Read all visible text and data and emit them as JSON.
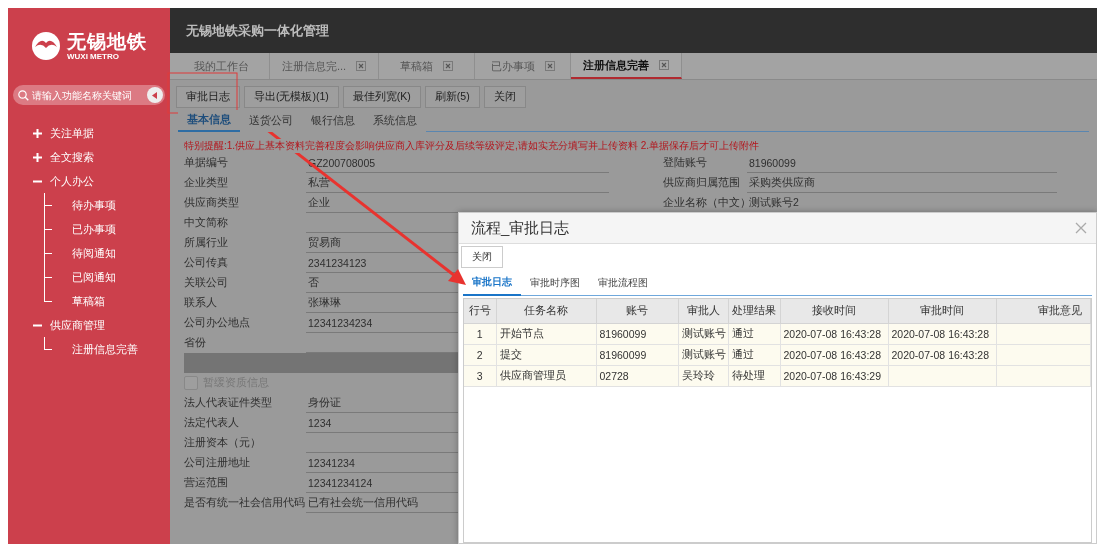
{
  "sidebar": {
    "logo": {
      "name": "无锡地铁",
      "subtitle": "WUXI METRO"
    },
    "search": {
      "placeholder": "请输入功能名称关键词"
    },
    "menu": [
      {
        "label": "关注单据",
        "expanded": false
      },
      {
        "label": "全文搜索",
        "expanded": false
      },
      {
        "label": "个人办公",
        "expanded": true,
        "children": [
          {
            "label": "待办事项"
          },
          {
            "label": "已办事项"
          },
          {
            "label": "待阅通知"
          },
          {
            "label": "已阅通知"
          },
          {
            "label": "草稿箱"
          }
        ]
      },
      {
        "label": "供应商管理",
        "expanded": true,
        "children": [
          {
            "label": "注册信息完善"
          }
        ]
      }
    ]
  },
  "header": {
    "title": "无锡地铁采购一体化管理"
  },
  "tabs": [
    {
      "label": "我的工作台",
      "closable": false,
      "selected": false
    },
    {
      "label": "注册信息完...",
      "closable": true,
      "selected": false
    },
    {
      "label": "草稿箱",
      "closable": true,
      "selected": false
    },
    {
      "label": "已办事项",
      "closable": true,
      "selected": false
    },
    {
      "label": "注册信息完善",
      "closable": true,
      "selected": true
    }
  ],
  "toolbar": [
    "审批日志",
    "导出(无模板)(1)",
    "最佳列宽(K)",
    "刷新(5)",
    "关闭"
  ],
  "subtabs": [
    {
      "label": "基本信息",
      "selected": true
    },
    {
      "label": "送货公司",
      "selected": false
    },
    {
      "label": "银行信息",
      "selected": false
    },
    {
      "label": "系统信息",
      "selected": false
    }
  ],
  "notice": "特别提醒:1.供应上基本资料完善程度会影响供应商入库评分及后续等级评定,请如实充分填写并上传资料 2.单据保存后才可上传附件",
  "form": {
    "left_fields": [
      {
        "label": "单据编号",
        "value": "GZ200708005"
      },
      {
        "label": "企业类型",
        "value": "私营"
      },
      {
        "label": "供应商类型",
        "value": "企业"
      },
      {
        "label": "中文简称"
      },
      {
        "label": "所属行业",
        "value": "贸易商"
      },
      {
        "label": "公司传真",
        "value": "2341234123"
      },
      {
        "label": "关联公司",
        "value": "否"
      },
      {
        "label": "联系人",
        "value": "张琳琳"
      },
      {
        "label": "公司办公地点",
        "value": "12341234234"
      },
      {
        "label": "省份"
      }
    ],
    "right_fields": [
      {
        "label": "登陆账号",
        "value": "81960099"
      },
      {
        "label": "供应商归属范围",
        "value": "采购类供应商"
      },
      {
        "label": "企业名称（中文）",
        "value": "测试账号2"
      }
    ],
    "checkbox": {
      "label": "暂缓资质信息",
      "checked": false
    },
    "more_fields": [
      {
        "label": "法人代表证件类型",
        "value": "身份证"
      },
      {
        "label": "法定代表人",
        "value": "1234"
      },
      {
        "label": "注册资本（元）"
      },
      {
        "label": "公司注册地址",
        "value": "12341234"
      },
      {
        "label": "营运范围",
        "value": "12341234124"
      },
      {
        "label": "是否有统一社会信用代码",
        "value": "已有社会统一信用代码"
      }
    ]
  },
  "dialog": {
    "title": "流程_审批日志",
    "close_button": "关闭",
    "tabs": [
      {
        "label": "审批日志",
        "selected": true
      },
      {
        "label": "审批时序图",
        "selected": false
      },
      {
        "label": "审批流程图",
        "selected": false
      }
    ],
    "table": {
      "columns": [
        "行号",
        "任务名称",
        "账号",
        "审批人",
        "处理结果",
        "接收时间",
        "审批时间",
        "审批意见"
      ],
      "rows": [
        [
          "1",
          "开始节点",
          "81960099",
          "测试账号",
          "通过",
          "2020-07-08 16:43:28",
          "2020-07-08 16:43:28",
          ""
        ],
        [
          "2",
          "提交",
          "81960099",
          "测试账号",
          "通过",
          "2020-07-08 16:43:28",
          "2020-07-08 16:43:28",
          ""
        ],
        [
          "3",
          "供应商管理员",
          "02728",
          "吴玲玲",
          "待处理",
          "2020-07-08 16:43:29",
          "",
          ""
        ]
      ]
    }
  }
}
